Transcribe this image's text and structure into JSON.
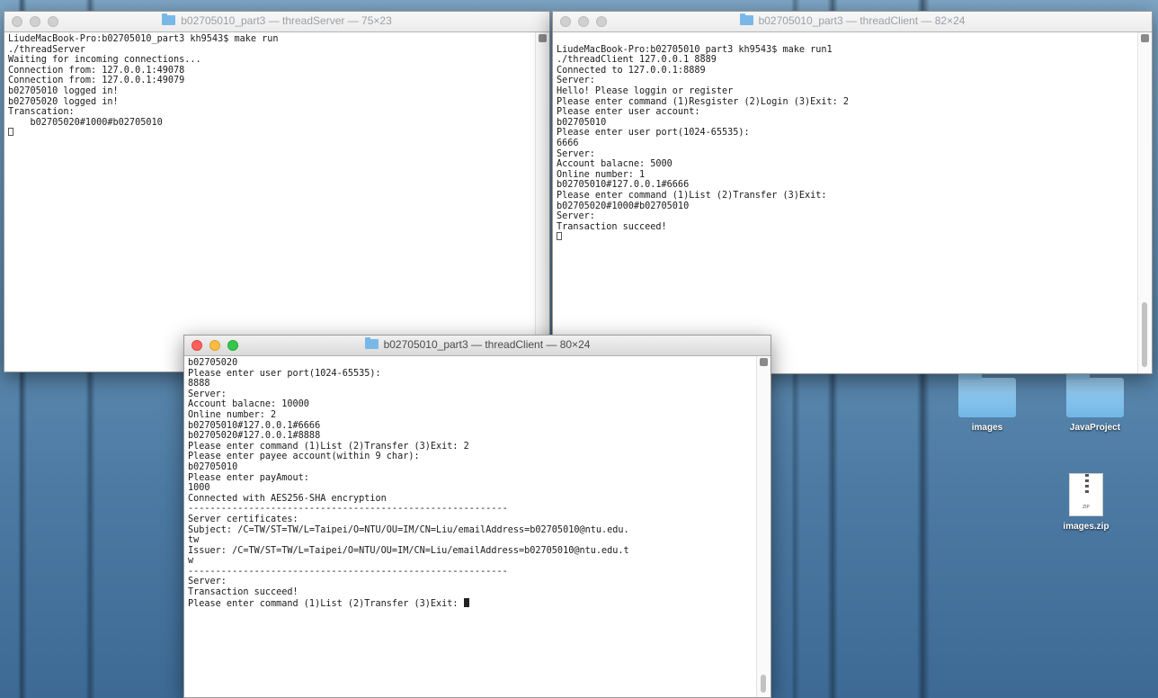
{
  "desktop": {
    "icons": [
      {
        "label": "images",
        "icon": "folder-icon"
      },
      {
        "label": "JavaProject",
        "icon": "folder-icon"
      },
      {
        "label": "images.zip",
        "icon": "zip-file-icon",
        "tag": "ZIP"
      }
    ]
  },
  "colors": {
    "close": "#fc605c",
    "minimize": "#fdbc40",
    "maximize": "#34c84a",
    "folder": "#79b8e6"
  },
  "windows": {
    "server": {
      "title": "b02705010_part3 — threadServer — 75×23",
      "lines": [
        "LiudeMacBook-Pro:b02705010_part3 kh9543$ make run",
        "./threadServer",
        "Waiting for incoming connections...",
        "Connection from: 127.0.0.1:49078",
        "Connection from: 127.0.0.1:49079",
        "b02705010 logged in!",
        "b02705020 logged in!",
        "Transcation:",
        "    b02705020#1000#b02705010"
      ]
    },
    "client1": {
      "title": "b02705010_part3 — threadClient — 82×24",
      "lines": [
        "",
        "LiudeMacBook-Pro:b02705010_part3 kh9543$ make run1",
        "./threadClient 127.0.0.1 8889",
        "Connected to 127.0.0.1:8889",
        "Server:",
        "Hello! Please loggin or register",
        "Please enter command (1)Resgister (2)Login (3)Exit: 2",
        "Please enter user account:",
        "b02705010",
        "Please enter user port(1024-65535):",
        "6666",
        "Server:",
        "Account balacne: 5000",
        "Online number: 1",
        "b02705010#127.0.0.1#6666",
        "Please enter command (1)List (2)Transfer (3)Exit:",
        "b02705020#1000#b02705010",
        "Server:",
        "Transaction succeed!"
      ]
    },
    "client2": {
      "title": "b02705010_part3 — threadClient — 80×24",
      "lines": [
        "b02705020",
        "Please enter user port(1024-65535):",
        "8888",
        "Server:",
        "Account balacne: 10000",
        "Online number: 2",
        "b02705010#127.0.0.1#6666",
        "b02705020#127.0.0.1#8888",
        "Please enter command (1)List (2)Transfer (3)Exit: 2",
        "Please enter payee account(within 9 char):",
        "b02705010",
        "Please enter payAmout:",
        "1000",
        "Connected with AES256-SHA encryption",
        "----------------------------------------------------------",
        "Server certificates:",
        "Subject: /C=TW/ST=TW/L=Taipei/O=NTU/OU=IM/CN=Liu/emailAddress=b02705010@ntu.edu.",
        "tw",
        "Issuer: /C=TW/ST=TW/L=Taipei/O=NTU/OU=IM/CN=Liu/emailAddress=b02705010@ntu.edu.t",
        "w",
        "----------------------------------------------------------",
        "Server:",
        "Transaction succeed!"
      ],
      "prompt": "Please enter command (1)List (2)Transfer (3)Exit: "
    }
  }
}
